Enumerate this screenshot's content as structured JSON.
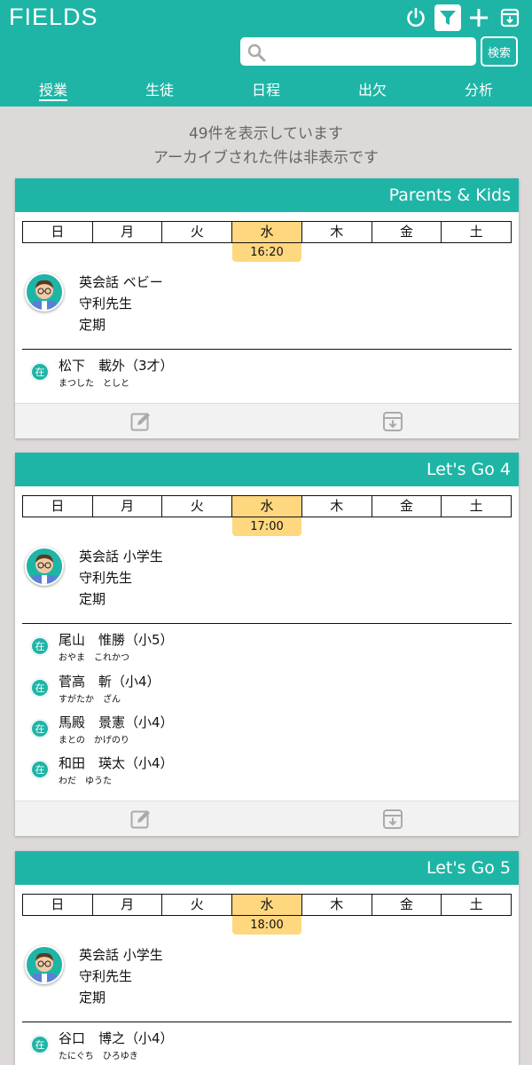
{
  "app": {
    "title": "FIELDS"
  },
  "header": {
    "icons": [
      "power-icon",
      "filter-icon",
      "plus-icon",
      "archive-icon"
    ],
    "search": {
      "placeholder": "",
      "value": "",
      "button_label": "検索"
    }
  },
  "tabs": [
    {
      "label": "授業",
      "active": true
    },
    {
      "label": "生徒",
      "active": false
    },
    {
      "label": "日程",
      "active": false
    },
    {
      "label": "出欠",
      "active": false
    },
    {
      "label": "分析",
      "active": false
    }
  ],
  "summary": {
    "line1": "49件を表示しています",
    "line2": "アーカイブされた件は非表示です"
  },
  "weekdays": [
    "日",
    "月",
    "火",
    "水",
    "木",
    "金",
    "土"
  ],
  "colors": {
    "accent": "#1eb5a6",
    "highlight": "#ffd77f",
    "background": "#dcd9d8"
  },
  "classes": [
    {
      "title": "Parents & Kids",
      "active_day": "水",
      "time": "16:20",
      "course": "英会話 ベビー",
      "teacher": "守利先生",
      "type": "定期",
      "students": [
        {
          "badge": "在",
          "name": "松下　載外（3才）",
          "kana": "まつした　としと"
        }
      ]
    },
    {
      "title": "Let's Go 4",
      "active_day": "水",
      "time": "17:00",
      "course": "英会話 小学生",
      "teacher": "守利先生",
      "type": "定期",
      "students": [
        {
          "badge": "在",
          "name": "尾山　惟勝（小5）",
          "kana": "おやま　これかつ"
        },
        {
          "badge": "在",
          "name": "菅高　斬（小4）",
          "kana": "すがたか　ざん"
        },
        {
          "badge": "在",
          "name": "馬殿　景憲（小4）",
          "kana": "まとの　かげのり"
        },
        {
          "badge": "在",
          "name": "和田　瑛太（小4）",
          "kana": "わだ　ゆうた"
        }
      ]
    },
    {
      "title": "Let's Go 5",
      "active_day": "水",
      "time": "18:00",
      "course": "英会話 小学生",
      "teacher": "守利先生",
      "type": "定期",
      "students": [
        {
          "badge": "在",
          "name": "谷口　博之（小4）",
          "kana": "たにぐち　ひろゆき"
        }
      ]
    }
  ]
}
